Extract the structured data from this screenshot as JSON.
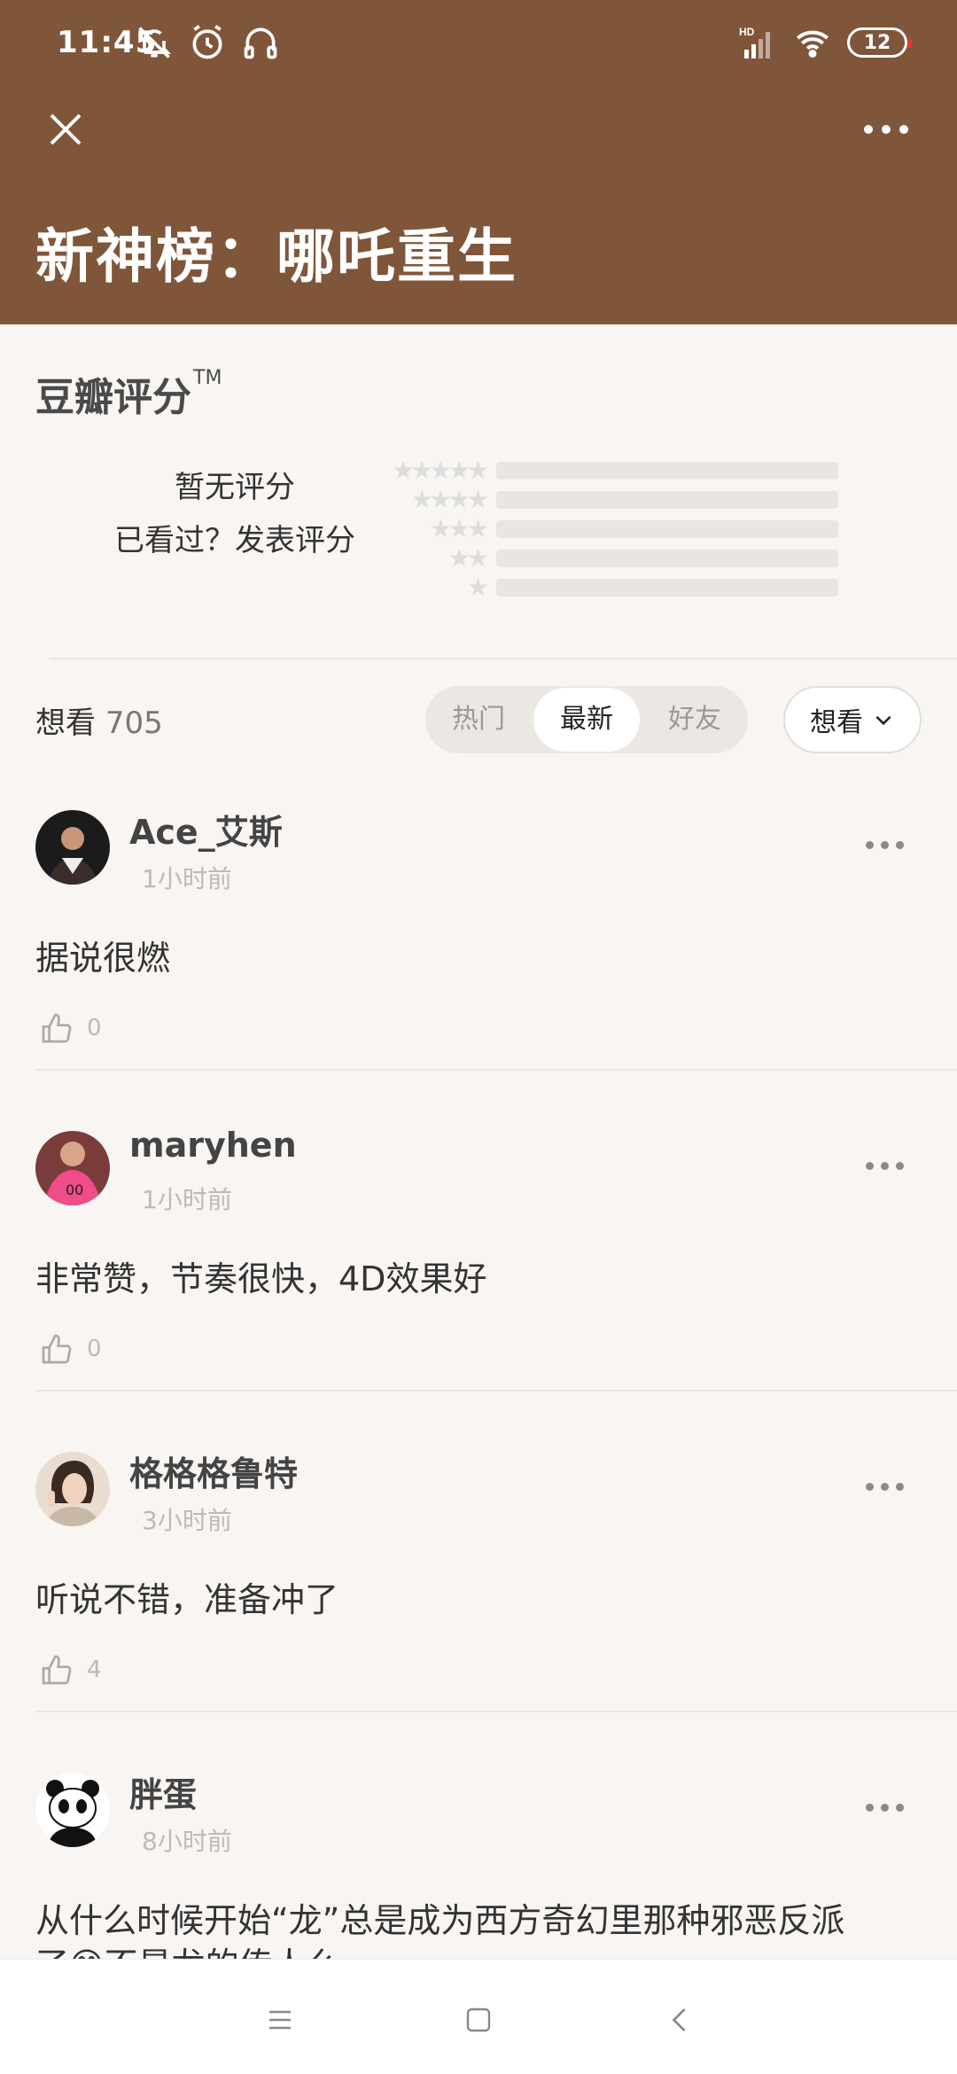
{
  "status": {
    "time": "11:45",
    "battery": "12",
    "network": "HD"
  },
  "header": {
    "title": "新神榜：哪吒重生"
  },
  "rating": {
    "heading": "豆瓣评分",
    "tm": "TM",
    "no_rating": "暂无评分",
    "prompt": "已看过？发表评分"
  },
  "filters": {
    "want_label": "想看",
    "want_count": "705",
    "tabs": [
      "热门",
      "最新",
      "好友"
    ],
    "active_tab": "最新",
    "dropdown": "想看"
  },
  "comments": [
    {
      "user": "Ace_艾斯",
      "time": "1小时前",
      "text": "据说很燃",
      "likes": "0"
    },
    {
      "user": "maryhen",
      "time": "1小时前",
      "text": "非常赞，节奏很快，4D效果好",
      "likes": "0"
    },
    {
      "user": "格格格鲁特",
      "time": "3小时前",
      "text": "听说不错，准备冲了",
      "likes": "4"
    },
    {
      "user": "胖蛋",
      "time": "8小时前",
      "text": "从什么时候开始“龙”总是成为西方奇幻里那种邪恶反派",
      "text2": "了😊不是龙的传人么"
    }
  ],
  "colors": {
    "header_bg": "#80563a",
    "page_bg": "#f8f5f2"
  }
}
